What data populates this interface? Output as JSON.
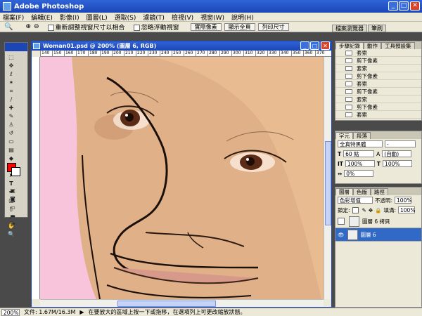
{
  "app": {
    "title": "Adobe Photoshop"
  },
  "menu": [
    "檔案(F)",
    "編輯(E)",
    "影像(I)",
    "圖層(L)",
    "選取(S)",
    "濾鏡(T)",
    "檢視(V)",
    "視窗(W)",
    "說明(H)"
  ],
  "options": {
    "zoom_icon": "magnifier-icon",
    "resize_windows_label": "重新調整視窗尺寸以相合",
    "ignore_palettes_label": "忽略浮動視窗",
    "actual_pixels": "實際像素",
    "fit_on_screen": "顯示全頁",
    "print_size": "列印尺寸"
  },
  "palette_well": [
    "檔案瀏覽器",
    "筆刷"
  ],
  "document": {
    "title": "Woman01.psd @ 200% (圖層 6, RGB)",
    "ruler_ticks": [
      "140",
      "150",
      "160",
      "170",
      "180",
      "190",
      "200",
      "210",
      "220",
      "230",
      "240",
      "250",
      "260",
      "270",
      "280",
      "290",
      "300",
      "310",
      "320",
      "330",
      "340",
      "350",
      "360",
      "370"
    ]
  },
  "history": {
    "tabs": [
      "步驟記錄",
      "動作",
      "工具預設集"
    ],
    "items": [
      "套索",
      "剪下像素",
      "套索",
      "剪下像素",
      "套索",
      "剪下像素",
      "套索",
      "剪下像素",
      "套索",
      "剪下像素"
    ]
  },
  "character": {
    "tabs": [
      "字元",
      "段落"
    ],
    "font": "全真特黑體",
    "style": "-",
    "size": "60 點",
    "leading": "(自動)",
    "scale_v": "100%",
    "scale_h": "100%",
    "tracking": "0%"
  },
  "layers": {
    "tabs": [
      "圖層",
      "色版",
      "路徑"
    ],
    "blend_mode": "色彩增值",
    "opacity_label": "不透明:",
    "opacity": "100%",
    "lock_label": "鎖定:",
    "fill_label": "填滿:",
    "fill": "100%",
    "items": [
      {
        "name": "圖層 6 拷貝",
        "selected": false
      },
      {
        "name": "圖層 6",
        "selected": true
      }
    ]
  },
  "status": {
    "zoom": "200%",
    "doc": "文件: 1.67M/16.3M",
    "hint": "在要放大的區域上按一下或拖移，在選項列上可更改縮放狀態。"
  },
  "colors": {
    "foreground": "#ff0000",
    "background": "#ffffff",
    "accent": "#1c46b6"
  }
}
